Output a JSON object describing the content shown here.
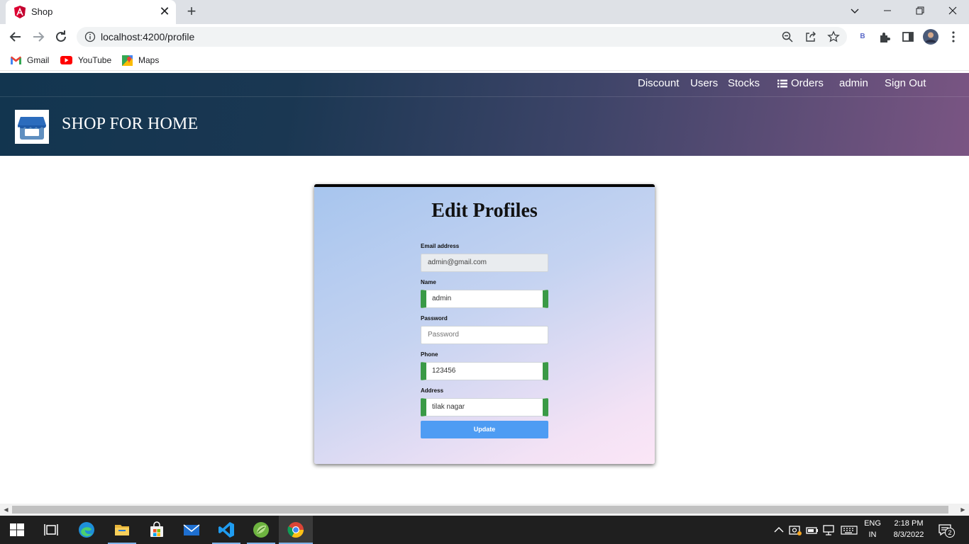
{
  "browser": {
    "tab_title": "Shop",
    "url": "localhost:4200/profile",
    "bookmarks": [
      "Gmail",
      "YouTube",
      "Maps"
    ],
    "extension_badge": "B"
  },
  "app": {
    "brand": "SHOP FOR HOME",
    "nav": {
      "discount": "Discount",
      "users": "Users",
      "stocks": "Stocks",
      "orders": "Orders",
      "admin": "admin",
      "signout": "Sign Out"
    }
  },
  "form": {
    "title": "Edit Profiles",
    "email_label": "Email address",
    "email_value": "admin@gmail.com",
    "name_label": "Name",
    "name_value": "admin",
    "password_label": "Password",
    "password_placeholder": "Password",
    "phone_label": "Phone",
    "phone_value": "123456",
    "address_label": "Address",
    "address_value": "tilak nagar",
    "submit_label": "Update",
    "valid_color": "#3a9a46",
    "button_color": "#4e9cf3"
  },
  "taskbar": {
    "lang_top": "ENG",
    "lang_bottom": "IN",
    "time": "2:18 PM",
    "date": "8/3/2022",
    "notification_count": "2"
  }
}
